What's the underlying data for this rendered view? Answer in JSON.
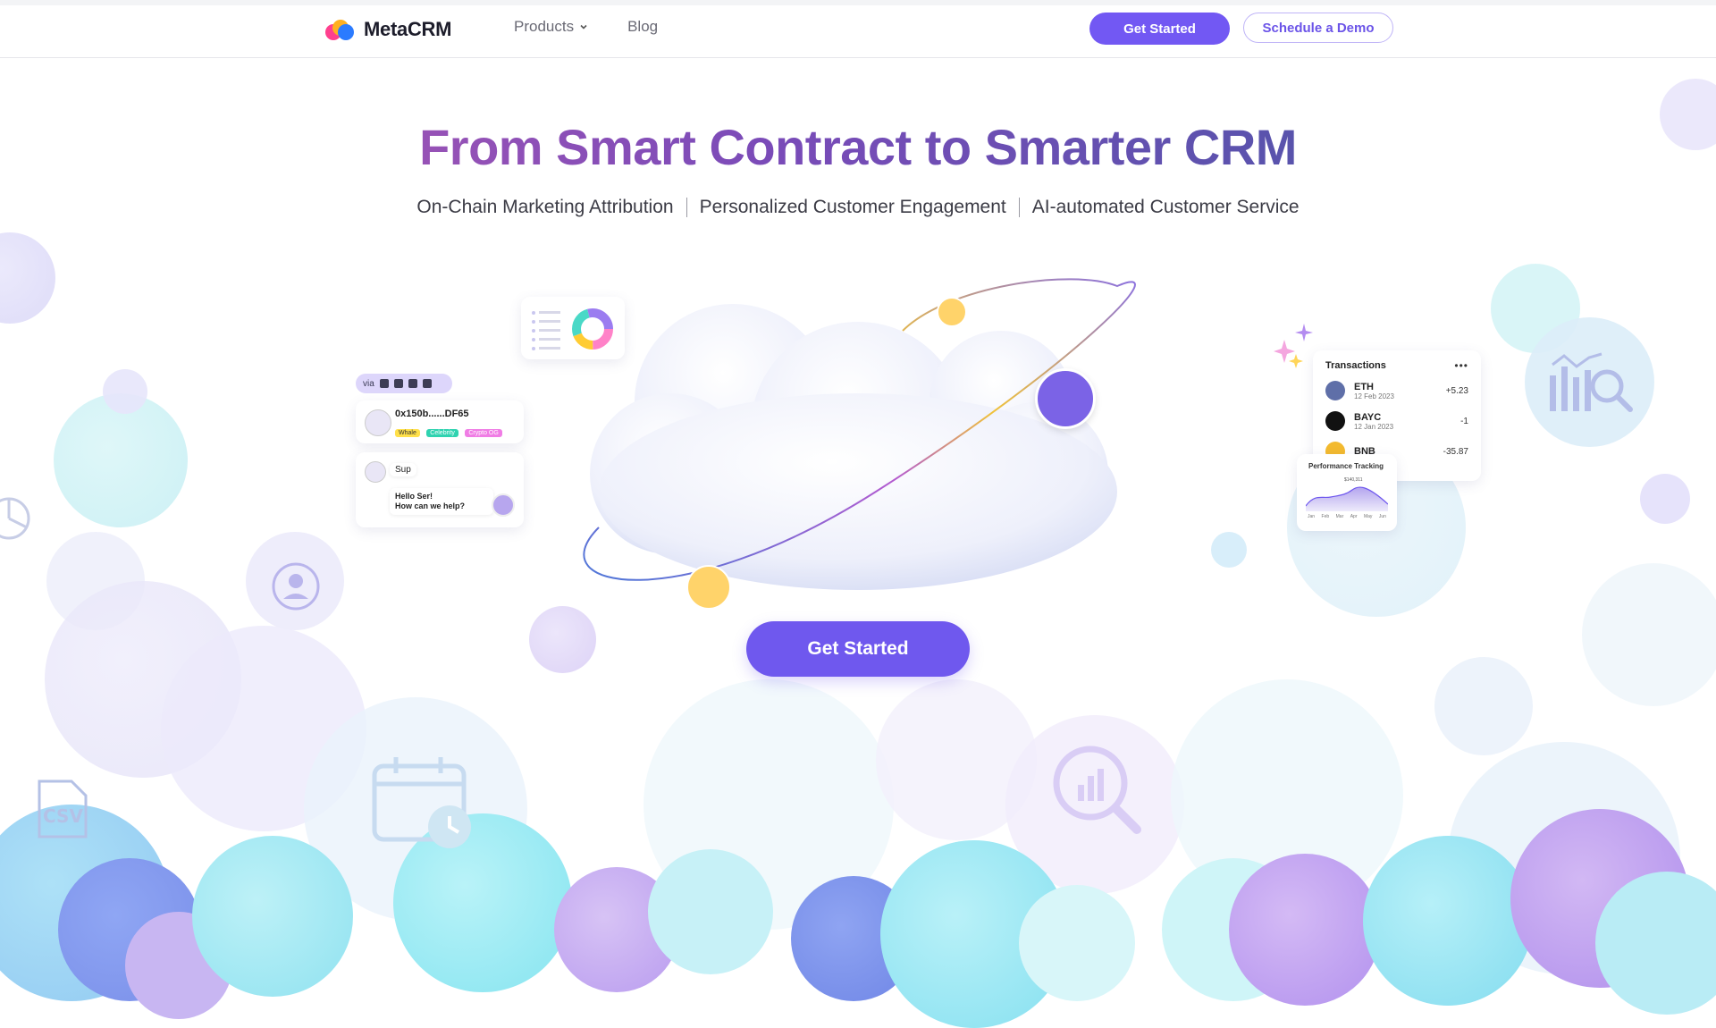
{
  "header": {
    "brand": "MetaCRM",
    "nav": [
      {
        "label": "Products",
        "has_dropdown": true
      },
      {
        "label": "Blog",
        "has_dropdown": false
      }
    ],
    "cta_primary": "Get Started",
    "cta_secondary": "Schedule a Demo"
  },
  "hero": {
    "title": "From Smart Contract to Smarter CRM",
    "subtitle_items": [
      "On-Chain Marketing Attribution",
      "Personalized Customer Engagement",
      "AI-automated Customer Service"
    ],
    "cta": "Get Started"
  },
  "profile_card": {
    "via_label": "via",
    "address": "0x150b......DF65",
    "tags": [
      "Whale",
      "Celebrity",
      "Crypto OG"
    ]
  },
  "chat_card": {
    "user_message": "Sup",
    "reply_line1": "Hello Ser!",
    "reply_line2": "How can we help?"
  },
  "transactions_card": {
    "title": "Transactions",
    "menu_icon": "more-horizontal-icon",
    "rows": [
      {
        "name": "ETH",
        "date": "12 Feb 2023",
        "amount": "+5.23"
      },
      {
        "name": "BAYC",
        "date": "12 Jan 2023",
        "amount": "-1"
      },
      {
        "name": "BNB",
        "date": "",
        "amount": "-35.87"
      }
    ]
  },
  "performance_card": {
    "title": "Performance Tracking",
    "peak_label": "$140,311",
    "months": [
      "Jan",
      "Feb",
      "Mar",
      "Apr",
      "May",
      "Jun"
    ]
  },
  "decor_icons": [
    "csv-icon",
    "calendar-clock-icon",
    "chart-search-icon",
    "bar-chart-search-icon",
    "user-icon",
    "pie-chart-icon"
  ],
  "colors": {
    "accent": "#7258f3",
    "title_gradient_start": "#b95bb4",
    "title_gradient_end": "#3e5aa3"
  }
}
